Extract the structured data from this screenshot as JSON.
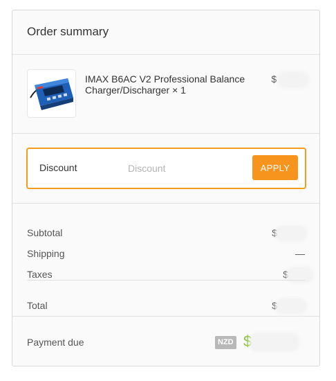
{
  "summary": {
    "title": "Order summary"
  },
  "product": {
    "name": "IMAX B6AC V2 Professional Balance Charger/Discharger",
    "quantity": "× 1",
    "price_prefix": "$"
  },
  "discount": {
    "label": "Discount",
    "placeholder": "Discount",
    "apply_label": "APPLY"
  },
  "totals": {
    "subtotal_label": "Subtotal",
    "subtotal_prefix": "$",
    "shipping_label": "Shipping",
    "shipping_value": "—",
    "taxes_label": "Taxes",
    "taxes_prefix": "$",
    "total_label": "Total",
    "total_prefix": "$"
  },
  "payment": {
    "label": "Payment due",
    "currency": "NZD",
    "amount_prefix": "$"
  },
  "colors": {
    "accent": "#f7941e",
    "amount": "#8cc43f",
    "badge": "#b8b8b8"
  }
}
